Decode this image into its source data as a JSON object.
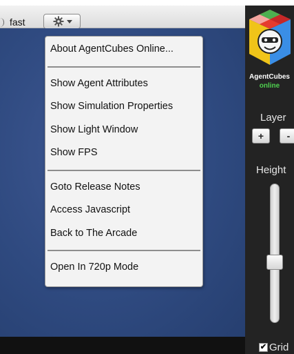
{
  "toolbar": {
    "speed_label": "fast"
  },
  "sidebar": {
    "brand": "AgentCubes",
    "status": "online",
    "layer_label": "Layer",
    "layer_plus": "+",
    "layer_minus": "-",
    "height_label": "Height",
    "height_slider_value": 0.43,
    "grid_label": "Grid",
    "grid_checked": true
  },
  "menu": {
    "groups": [
      [
        "About AgentCubes Online..."
      ],
      [
        "Show Agent Attributes",
        "Show Simulation Properties",
        "Show Light Window",
        "Show FPS"
      ],
      [
        "Goto Release Notes",
        "Access Javascript",
        "Back to The Arcade"
      ],
      [
        "Open In 720p Mode"
      ]
    ]
  },
  "colors": {
    "world_background": "#2f4a80",
    "sidebar_background": "#232323",
    "online_status": "#4fd14f"
  },
  "icons": [
    "speed-slider-knob-icon",
    "gear-icon",
    "chevron-down-icon",
    "agentcubes-logo",
    "checkmark-icon"
  ]
}
